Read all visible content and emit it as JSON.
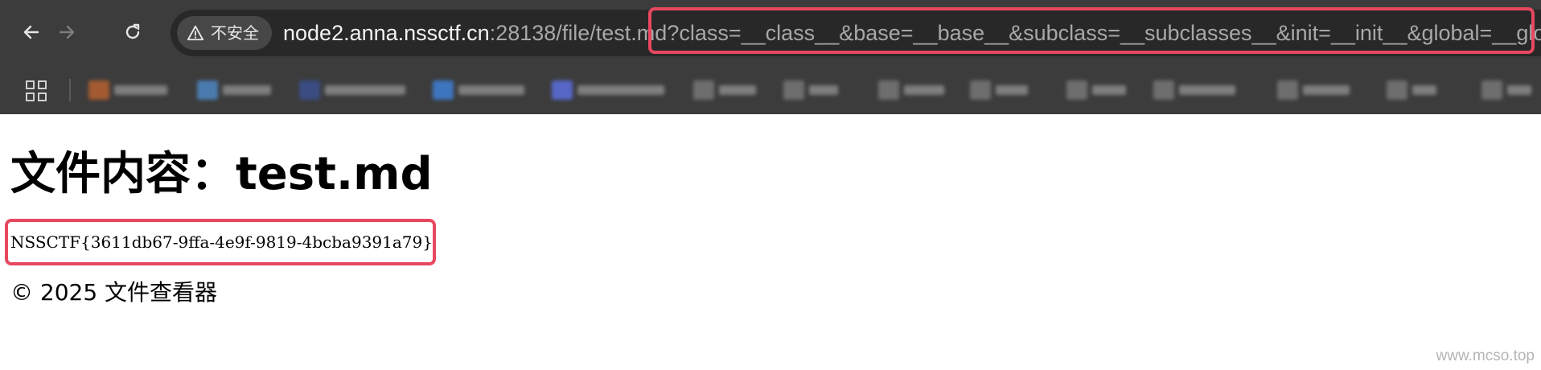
{
  "browser": {
    "security_label": "不安全",
    "url": {
      "host": "node2.anna.nssctf.cn",
      "path": ":28138/file/test.md",
      "query": "?class=__class__&base=__base__&subclass=__subclasses__&init=__init__&global=__globals__"
    },
    "icons": {
      "back": "back-arrow-icon",
      "forward": "forward-arrow-icon",
      "reload": "reload-icon",
      "security": "warning-triangle-icon",
      "apps": "apps-grid-icon"
    },
    "bookmark_count": 15
  },
  "page": {
    "title": "文件内容：test.md",
    "file_content": "NSSCTF{3611db67-9ffa-4e9f-9819-4bcba9391a79}",
    "footer": "© 2025 文件查看器"
  },
  "watermark": "www.mcso.top",
  "colors": {
    "highlight": "#e8485f",
    "chrome_bg": "#3c3c3c",
    "omnibox_bg": "#282828"
  }
}
